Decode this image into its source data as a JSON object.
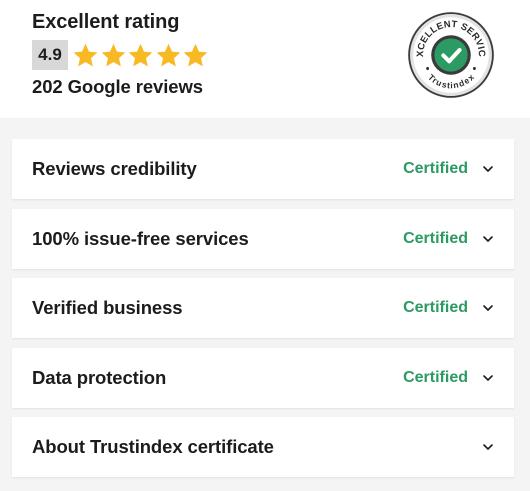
{
  "summary": {
    "title": "Excellent rating",
    "score": "4.9",
    "star_count": 5,
    "reviews": "202 Google reviews",
    "star_color": "#f7b924"
  },
  "badge": {
    "top_text": "EXCELLENT SERVICE",
    "bottom_text": "Trustindex",
    "check_color": "#2c9a63",
    "ring_color": "#3a3a3a"
  },
  "rows": [
    {
      "label": "Reviews credibility",
      "status": "Certified"
    },
    {
      "label": "100% issue-free services",
      "status": "Certified"
    },
    {
      "label": "Verified business",
      "status": "Certified"
    },
    {
      "label": "Data protection",
      "status": "Certified"
    },
    {
      "label": "About Trustindex certificate",
      "status": ""
    }
  ],
  "status_color": "#2c9a63"
}
